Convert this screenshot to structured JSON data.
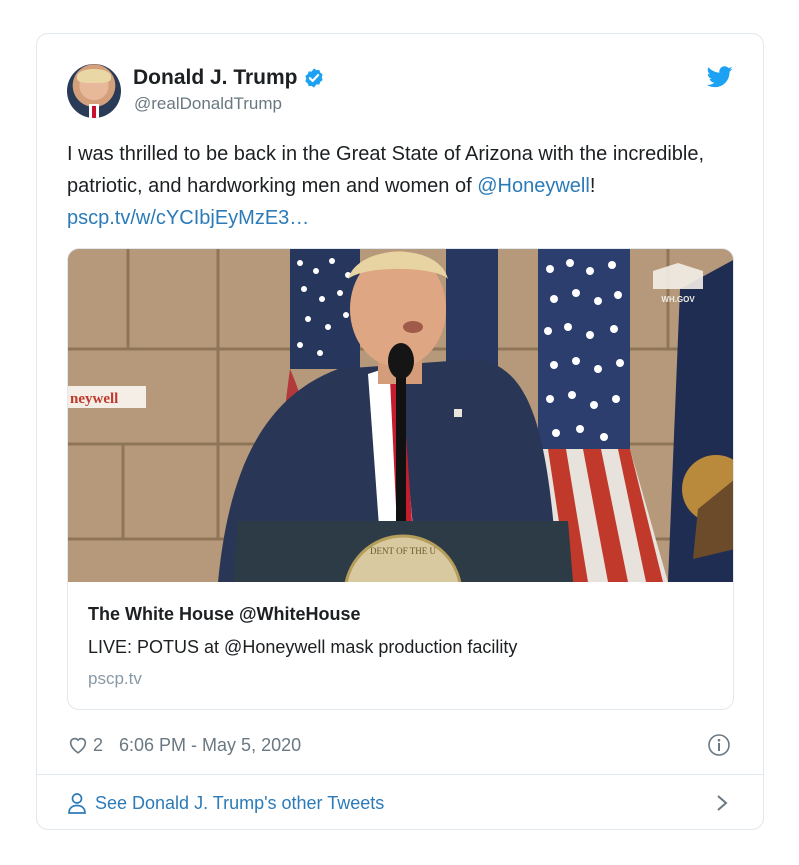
{
  "author": {
    "name": "Donald J. Trump",
    "handle": "@realDonaldTrump",
    "verified": true
  },
  "tweet": {
    "text_part1": "I was thrilled to be back in the Great State of Arizona with the incredible, patriotic, and hardworking men and women of ",
    "mention": "@Honeywell",
    "text_part2": "! ",
    "link": "pscp.tv/w/cYCIbjEyMzE3…"
  },
  "media": {
    "watermark": "WH.GOV",
    "banner_text": "neywell",
    "seal_text": "DENT OF THE U"
  },
  "card": {
    "title": "The White House @WhiteHouse",
    "description": "LIVE: POTUS at @Honeywell mask production facility",
    "domain": "pscp.tv"
  },
  "stats": {
    "likes": "2",
    "timestamp": "6:06 PM - May 5, 2020"
  },
  "footer": {
    "other_tweets_label": "See Donald J. Trump's other Tweets"
  },
  "colors": {
    "link": "#2b7bb9",
    "twitter_blue": "#1da1f2",
    "secondary_text": "#697882",
    "border": "#e1e8ed"
  },
  "icons": [
    "verified-badge-icon",
    "twitter-bird-icon",
    "heart-icon",
    "info-icon",
    "person-icon",
    "chevron-right-icon"
  ]
}
